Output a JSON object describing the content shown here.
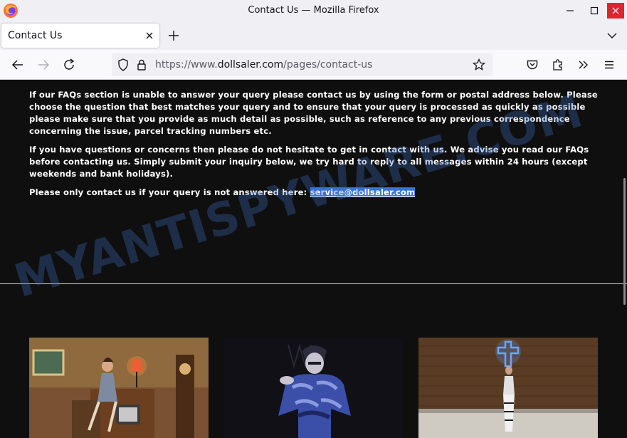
{
  "window": {
    "title": "Contact Us — Mozilla Firefox"
  },
  "tabs": [
    {
      "label": "Contact Us"
    }
  ],
  "urlbar": {
    "url_prefix": "https://www.",
    "domain": "dollsaler.com",
    "path": "/pages/contact-us"
  },
  "page": {
    "paragraph1": "If our FAQs section is unable to answer your query please contact us by using the form or postal address below. Please choose the question that best matches your query and to ensure that your query is processed as quickly as possible please make sure that you provide as much detail as possible, such as reference to any previous correspondence concerning the issue, parcel tracking numbers etc.",
    "paragraph2": "If you have questions or concerns then please do not hesitate to get in contact with us. We advise you read our FAQs before contacting us. Simply submit your inquiry below, we try hard to reply to all messages within 24 hours (except weekends and bank holidays).",
    "paragraph3_prefix": "Please only contact us if your query is not answered here: ",
    "email": "service@dollsaler.com",
    "watermark": "MYANTISPYWARE.COM"
  },
  "colors": {
    "page_bg": "#0f0f0f",
    "link_highlight": "#3b74d6",
    "close_button": "#e0242d"
  }
}
